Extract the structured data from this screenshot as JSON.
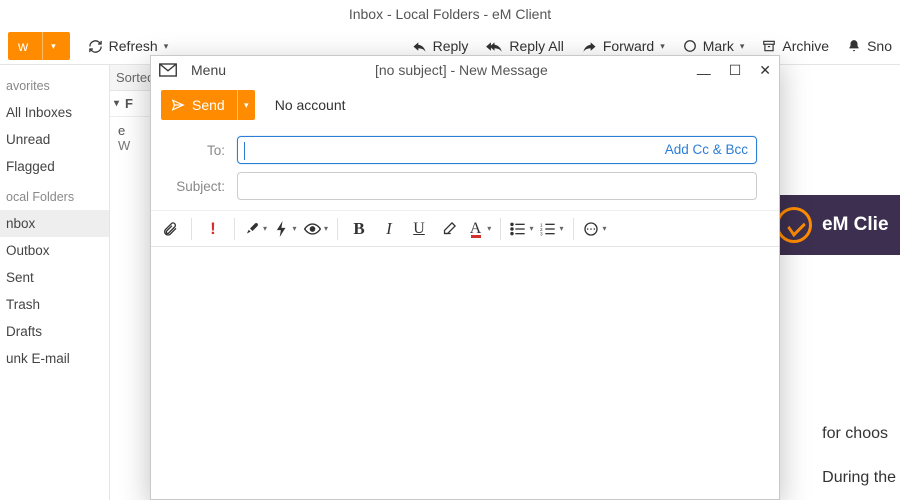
{
  "main": {
    "title": "Inbox - Local Folders - eM Client",
    "toolbar": {
      "new_label": "New",
      "refresh_label": "Refresh",
      "reply_label": "Reply",
      "reply_all_label": "Reply All",
      "forward_label": "Forward",
      "mark_label": "Mark",
      "archive_label": "Archive",
      "snooze_label": "Sno"
    },
    "sidebar": {
      "fav_header": "avorites",
      "fav_items": [
        "All Inboxes",
        "Unread",
        "Flagged"
      ],
      "local_header": "ocal Folders",
      "local_items": [
        "nbox",
        "Outbox",
        "Sent",
        "Trash",
        "Drafts",
        "unk E-mail"
      ],
      "active_index": 0
    },
    "middle": {
      "sorted_label": "Sorted",
      "group_label": "F",
      "msg_sender": "e",
      "msg_preview": "W"
    },
    "reader": {
      "brand_text": "eM Clie",
      "para1": "for choos",
      "para2": "During the"
    }
  },
  "compose": {
    "menu_label": "Menu",
    "title": "[no subject] - New Message",
    "send_label": "Send",
    "no_account": "No account",
    "to_label": "To:",
    "subject_label": "Subject:",
    "add_cc_bcc": "Add Cc & Bcc"
  }
}
